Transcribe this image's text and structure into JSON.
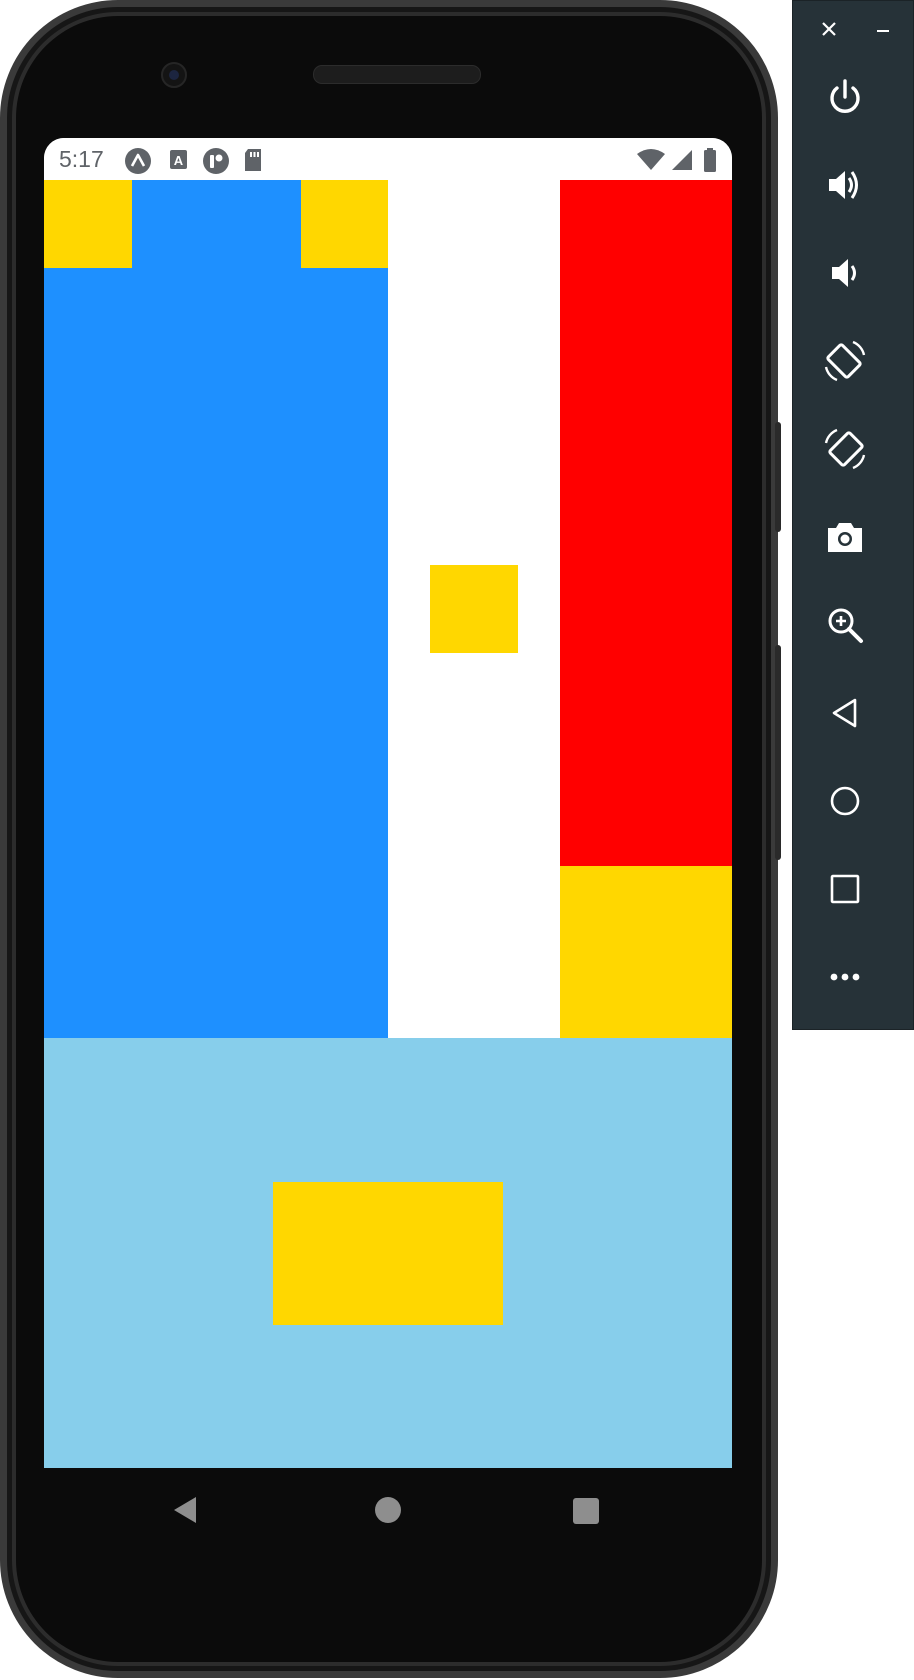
{
  "status_bar": {
    "time": "5:17",
    "left_icons": [
      "expo-icon",
      "accessibility-a-icon",
      "app-notification-icon",
      "sd-card-icon"
    ],
    "right_icons": [
      "wifi-icon",
      "signal-icon",
      "battery-icon"
    ]
  },
  "layout": {
    "colors": {
      "blue": "#1e90ff",
      "white": "#ffffff",
      "red": "#ff0000",
      "yellow": "#ffd700",
      "light_blue": "#87ceeb"
    }
  },
  "nav_bar": {
    "buttons": [
      "back-icon",
      "home-icon",
      "recents-icon"
    ]
  },
  "emulator_toolbar": {
    "window_controls": [
      "close-icon",
      "minimize-icon"
    ],
    "buttons": [
      "power-icon",
      "volume-up-icon",
      "volume-down-icon",
      "rotate-left-icon",
      "rotate-right-icon",
      "camera-icon",
      "zoom-icon",
      "back-icon",
      "home-icon",
      "overview-icon",
      "more-icon"
    ]
  }
}
